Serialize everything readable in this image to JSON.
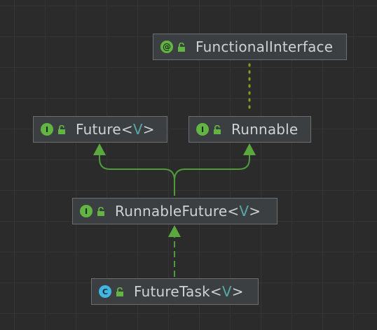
{
  "colors": {
    "background": "#2b2b2b",
    "node_fill": "#3c3f41",
    "node_border": "#6b6f72",
    "text": "#cfd2d5",
    "interface_badge": "#62b543",
    "class_badge": "#40b6e0",
    "edge": "#4f9a3a",
    "annotation_edge": "#8a9a1e"
  },
  "nodes": {
    "functional_interface": {
      "badge": "@",
      "kind": "annotation",
      "name": "FunctionalInterface",
      "generic": ""
    },
    "future": {
      "badge": "I",
      "kind": "interface",
      "name": "Future",
      "generic": "V"
    },
    "runnable": {
      "badge": "I",
      "kind": "interface",
      "name": "Runnable",
      "generic": ""
    },
    "runnable_future": {
      "badge": "I",
      "kind": "interface",
      "name": "RunnableFuture",
      "generic": "V"
    },
    "future_task": {
      "badge": "C",
      "kind": "class",
      "name": "FutureTask",
      "generic": "V"
    }
  },
  "edges": [
    {
      "from": "runnable_future",
      "to": "future",
      "type": "extends"
    },
    {
      "from": "runnable_future",
      "to": "runnable",
      "type": "extends"
    },
    {
      "from": "future_task",
      "to": "runnable_future",
      "type": "implements"
    },
    {
      "from": "runnable",
      "to": "functional_interface",
      "type": "annotated-with"
    }
  ]
}
